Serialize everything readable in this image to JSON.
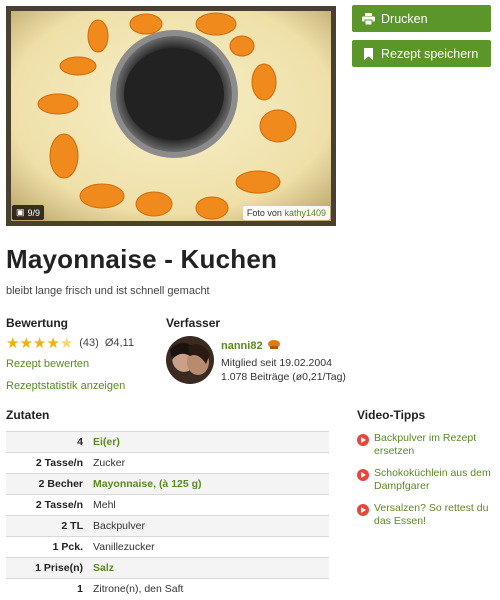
{
  "photo": {
    "counter": "9/9",
    "credit_prefix": "Foto von",
    "credit_user": "kathy1409"
  },
  "actions": {
    "print_label": "Drucken",
    "save_label": "Rezept speichern"
  },
  "recipe": {
    "title": "Mayonnaise - Kuchen",
    "subtitle": "bleibt lange frisch und ist schnell gemacht"
  },
  "rating": {
    "heading": "Bewertung",
    "stars_value": 4.11,
    "stars_max": 5,
    "count": "(43)",
    "average": "Ø4,11",
    "rate_link": "Rezept bewerten",
    "stats_link": "Rezeptstatistik anzeigen"
  },
  "author": {
    "heading": "Verfasser",
    "name": "nanni82",
    "member_since": "Mitglied seit 19.02.2004",
    "posts": "1.078 Beiträge (ø0,21/Tag)"
  },
  "ingredients": {
    "heading": "Zutaten",
    "items": [
      {
        "amount": "4",
        "name": "Ei(er)",
        "link": true
      },
      {
        "amount": "2 Tasse/n",
        "name": "Zucker",
        "link": false
      },
      {
        "amount": "2 Becher",
        "name": "Mayonnaise, (à 125 g)",
        "link": true
      },
      {
        "amount": "2 Tasse/n",
        "name": "Mehl",
        "link": false
      },
      {
        "amount": "2 TL",
        "name": "Backpulver",
        "link": false
      },
      {
        "amount": "1 Pck.",
        "name": "Vanillezucker",
        "link": false
      },
      {
        "amount": "1 Prise(n)",
        "name": "Salz",
        "link": true
      },
      {
        "amount": "1",
        "name": "Zitrone(n), den Saft",
        "link": false
      }
    ]
  },
  "videos": {
    "heading": "Video-Tipps",
    "items": [
      {
        "label": "Backpulver im Rezept ersetzen"
      },
      {
        "label": "Schokoküchlein aus dem Dampfgarer"
      },
      {
        "label": "Versalzen? So rettest du das Essen!"
      }
    ]
  },
  "colors": {
    "accent_green": "#5a962a",
    "link_green": "#5a8a22",
    "star": "#f0b400",
    "play_red": "#e8463a"
  }
}
